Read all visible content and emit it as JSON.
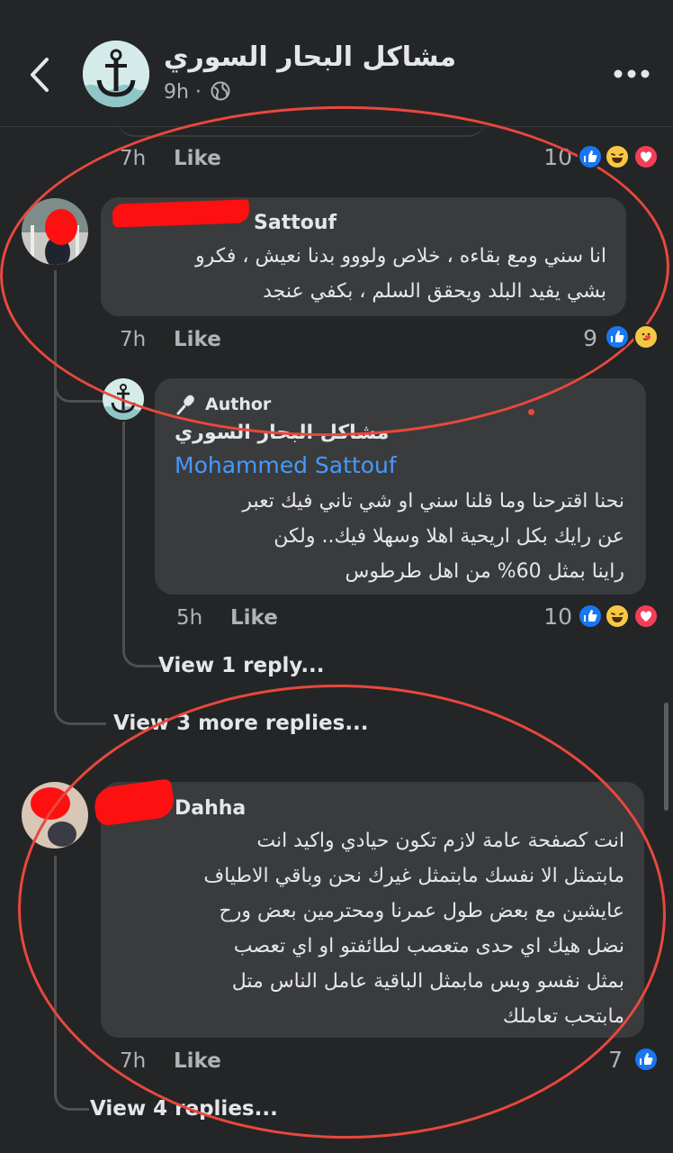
{
  "header": {
    "page_name": "مشاكل البحار السوري",
    "time": "9h ·",
    "icons": [
      "back-arrow-icon",
      "anchor-logo-icon",
      "globe-icon",
      "more-dots-icon"
    ]
  },
  "comments": [
    {
      "time": "7h",
      "like_label": "Like",
      "reaction_count": "10",
      "reactions": [
        "like",
        "haha",
        "love"
      ]
    },
    {
      "author": "Sattouf",
      "text_lines": [
        "انا سني ومع بقاءه ، خلاص ولووو بدنا نعيش ، فكرو",
        "بشي يفيد البلد ويحقق السلم ، بكفي عنجد"
      ],
      "time": "7h",
      "like_label": "Like",
      "reaction_count": "9",
      "reactions": [
        "like",
        "care"
      ]
    },
    {
      "badge": "Author",
      "author": "مشاكل البحار السوري",
      "mention": "Mohammed Sattouf",
      "text_lines": [
        "نحنا اقترحنا وما قلنا سني او شي تاني فيك تعبر",
        "عن رايك بكل اريحية اهلا وسهلا فيك.. ولكن",
        "راينا بمثل 60% من اهل طرطوس"
      ],
      "time": "5h",
      "like_label": "Like",
      "reaction_count": "10",
      "reactions": [
        "like",
        "haha",
        "love"
      ],
      "view_replies": "View 1 reply..."
    },
    {
      "view_replies": "View 3 more replies..."
    },
    {
      "author": "Dahha",
      "text_lines": [
        "انت كصفحة عامة لازم تكون حيادي واكيد انت",
        "مابتمثل الا نفسك مابتمثل غيرك نحن وباقي الاطياف",
        "عايشين مع بعض طول عمرنا ومحترمين بعض ورح",
        "نضل هيك اي حدى متعصب لطائفتو او اي تعصب",
        "بمثل نفسو وبس مابمثل الباقية عامل الناس متل",
        "مابتحب تعاملك"
      ],
      "time": "7h",
      "like_label": "Like",
      "reaction_count": "7",
      "reactions": [
        "like"
      ],
      "view_replies": "View 4 replies..."
    }
  ],
  "colors": {
    "background": "#242526",
    "bubble": "#3a3b3c",
    "link": "#4599ff",
    "annotation_red": "#e8483d",
    "like_blue": "#1877f2"
  }
}
